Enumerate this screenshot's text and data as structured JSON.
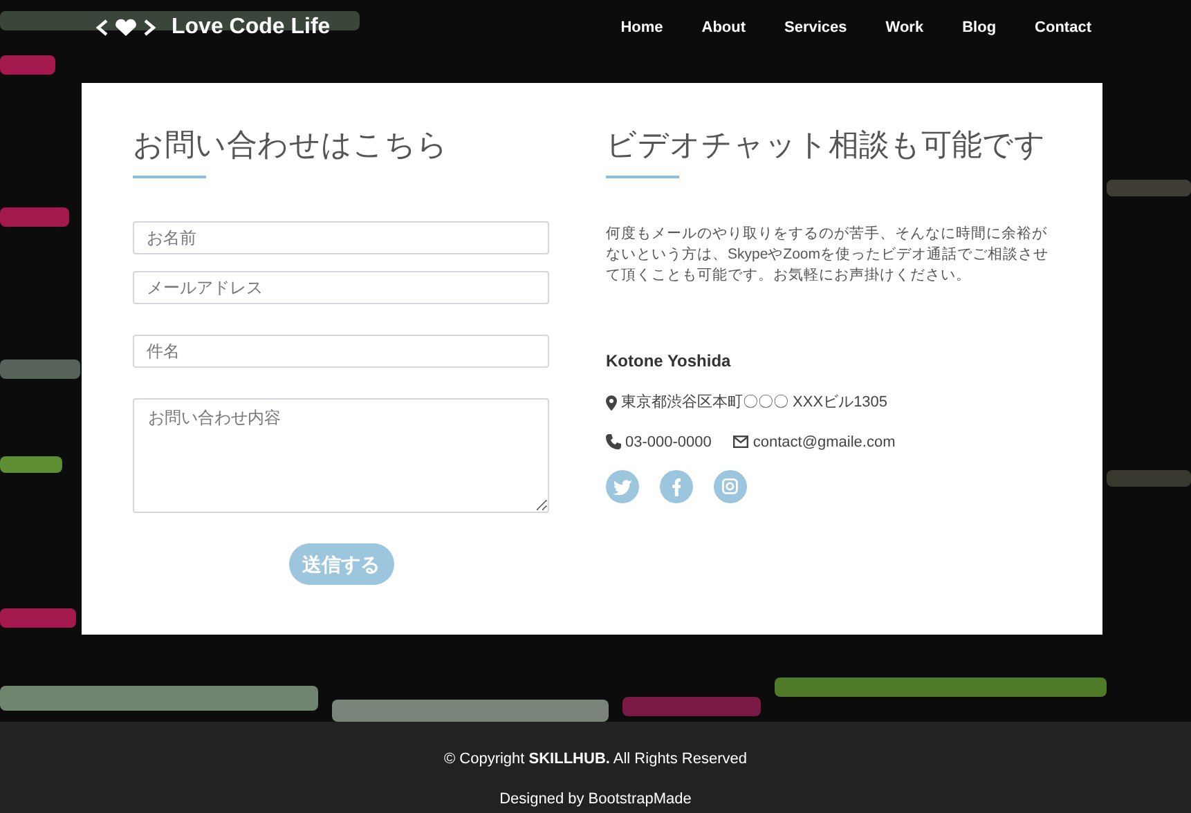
{
  "header": {
    "logo": "Love Code Life",
    "nav": [
      {
        "label": "Home"
      },
      {
        "label": "About"
      },
      {
        "label": "Services"
      },
      {
        "label": "Work"
      },
      {
        "label": "Blog"
      },
      {
        "label": "Contact"
      }
    ]
  },
  "contact_form": {
    "title": "お問い合わせはこちら",
    "fields": [
      {
        "kind": "input",
        "placeholder": "お名前"
      },
      {
        "kind": "input",
        "placeholder": "メールアドレス"
      },
      {
        "kind": "input",
        "placeholder": "件名"
      },
      {
        "kind": "textarea",
        "placeholder": "お問い合わせ内容"
      }
    ],
    "submit": "送信する"
  },
  "video_chat": {
    "title": "ビデオチャット相談も可能です",
    "text": "何度もメールのやり取りをするのが苦手、そんなに時間に余裕がないという方は、SkypeやZoomを使ったビデオ通話でご相談させて頂くことも可能です。お気軽にお声掛けください。",
    "name": "Kotone Yoshida",
    "address": "東京都渋谷区本町〇〇〇 XXXビル1305",
    "phone": "03-000-0000",
    "email": "contact@gmaile.com",
    "social": [
      {
        "kind": "twitter"
      },
      {
        "kind": "facebook"
      },
      {
        "kind": "instagram"
      }
    ]
  },
  "footer": {
    "copyright": "© Copyright **SKILLHUB.** All Rights Reserved",
    "credit": "Designed by BootstrapMade"
  }
}
